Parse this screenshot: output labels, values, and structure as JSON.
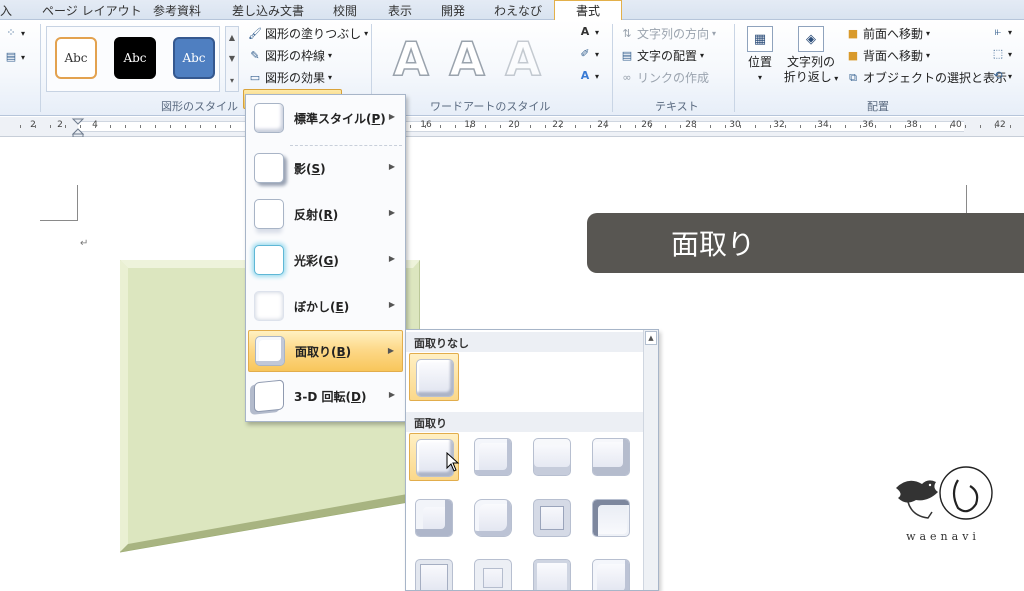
{
  "tabs": [
    {
      "id": "insert",
      "label": "入"
    },
    {
      "id": "page-layout",
      "label": "ページ レイアウト"
    },
    {
      "id": "references",
      "label": "参考資料"
    },
    {
      "id": "mailings",
      "label": "差し込み文書"
    },
    {
      "id": "review",
      "label": "校閲"
    },
    {
      "id": "view",
      "label": "表示"
    },
    {
      "id": "developer",
      "label": "開発"
    },
    {
      "id": "waenavi",
      "label": "わえなび"
    },
    {
      "id": "format",
      "label": "書式",
      "active": true
    }
  ],
  "ribbon": {
    "shape_styles": {
      "label": "図形のスタイル",
      "presets": [
        "Abc",
        "Abc",
        "Abc"
      ],
      "fill_label": "図形の塗りつぶし",
      "outline_label": "図形の枠線",
      "effects_label": "図形の効果"
    },
    "wordart": {
      "label": "ワードアートのスタイル",
      "letters": [
        "A",
        "A",
        "A"
      ]
    },
    "text": {
      "label": "テキスト",
      "direction_label": "文字列の方向",
      "align_label": "文字の配置",
      "link_label": "リンクの作成"
    },
    "arrange": {
      "label": "配置",
      "position_label": "位置",
      "wrap_label_1": "文字列の",
      "wrap_label_2": "折り返し",
      "bring_forward_label": "前面へ移動",
      "send_backward_label": "背面へ移動",
      "selection_pane_label": "オブジェクトの選択と表示"
    }
  },
  "ruler_labels": [
    "2",
    "2",
    "4",
    "16",
    "18",
    "20",
    "22",
    "24",
    "26",
    "28",
    "30",
    "32",
    "34",
    "36",
    "38",
    "40",
    "42"
  ],
  "effects_menu": {
    "items": [
      {
        "label": "標準スタイル",
        "key": "(P)",
        "keyletter": "P"
      },
      {
        "label": "影",
        "key": "(S)",
        "keyletter": "S"
      },
      {
        "label": "反射",
        "key": "(R)",
        "keyletter": "R"
      },
      {
        "label": "光彩",
        "key": "(G)",
        "keyletter": "G"
      },
      {
        "label": "ぼかし",
        "key": "(E)",
        "keyletter": "E"
      },
      {
        "label": "面取り",
        "key": "(B)",
        "keyletter": "B",
        "active": true
      },
      {
        "label": "3-D 回転",
        "key": "(D)",
        "keyletter": "D"
      }
    ]
  },
  "bevel_gallery": {
    "no_bevel_header": "面取りなし",
    "bevel_header": "面取り"
  },
  "banner": {
    "text": "面取り"
  },
  "logo": {
    "text": "waenavi"
  },
  "colors": {
    "accent": "#f8cc63",
    "banner_bg": "#585652",
    "shape_fill": "#dce6bf"
  }
}
